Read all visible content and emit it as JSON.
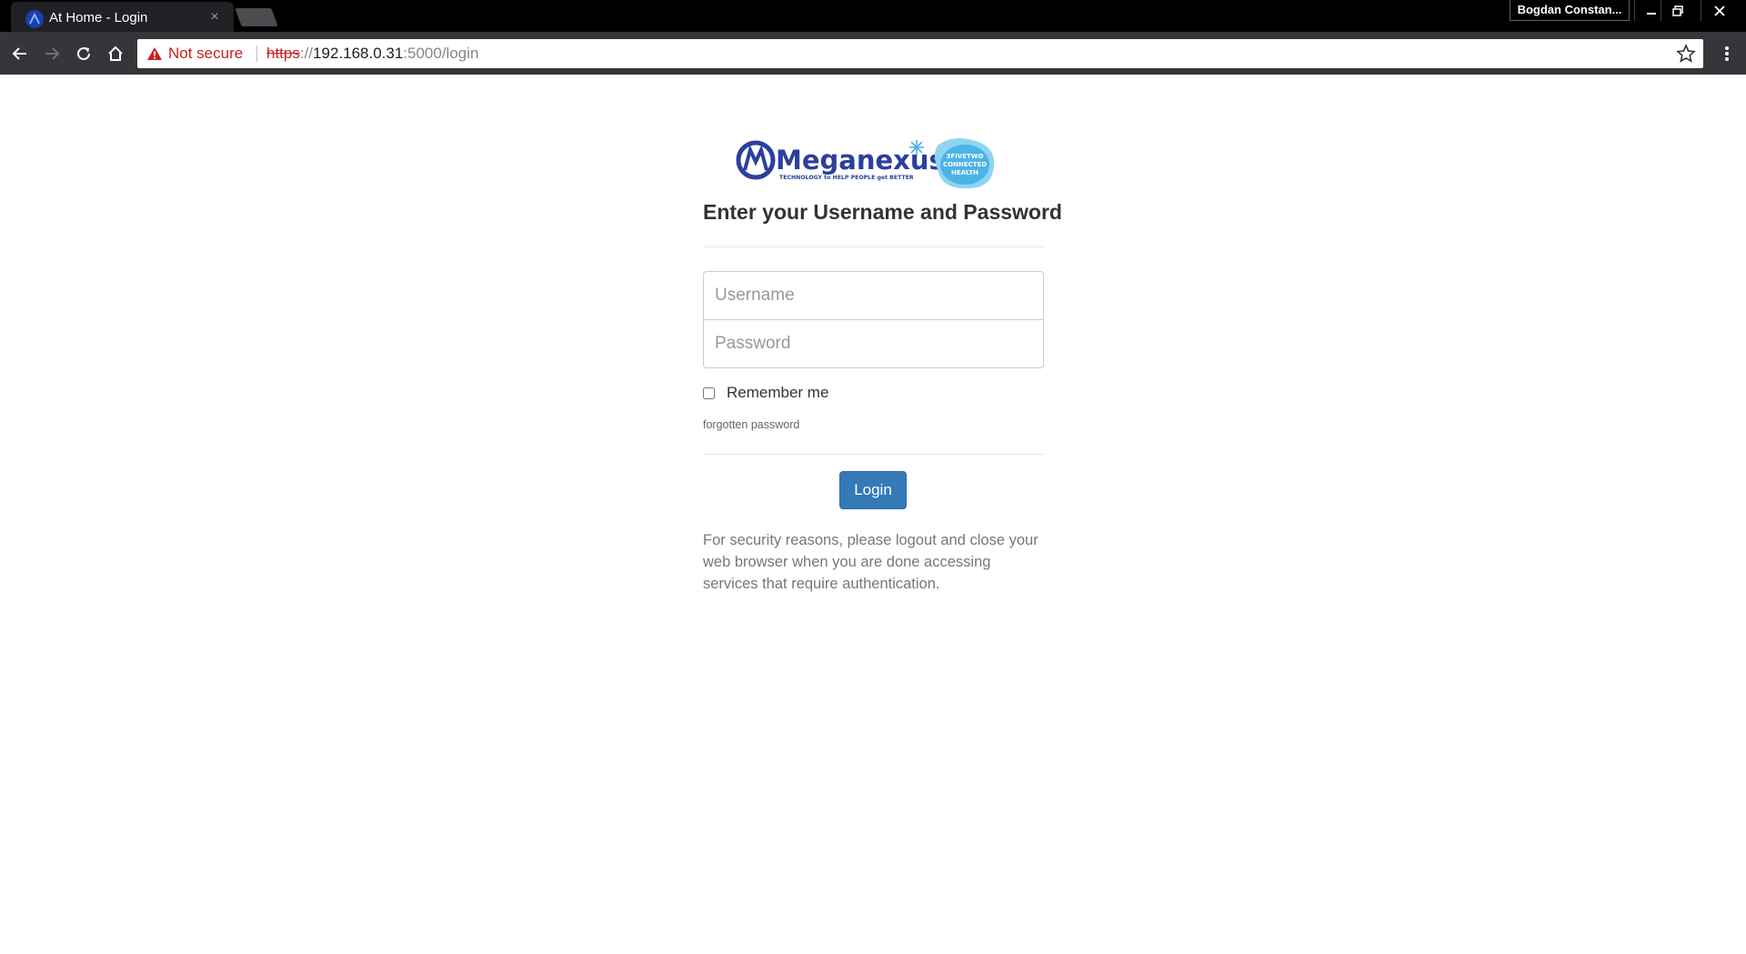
{
  "browser": {
    "tab_title": "At Home - Login",
    "tab_close": "×",
    "profile_name": "Bogdan Constan...",
    "security_label": "Not secure",
    "url_scheme": "https",
    "url_sep": "://",
    "url_host": "192.168.0.31",
    "url_rest": ":5000/login"
  },
  "login": {
    "heading": "Enter your Username and Password",
    "username_placeholder": "Username",
    "password_placeholder": "Password",
    "remember_label": "Remember me",
    "forgot_link": "forgotten password",
    "login_button": "Login",
    "security_notice": "For security reasons, please logout and close your web browser when you are done accessing services that require authentication."
  },
  "logos": {
    "brand_name": "Meganexus",
    "brand_tagline": "TECHNOLOGY to HELP PEOPLE get BETTER",
    "partner_line1": "3FIVETWO",
    "partner_line2": "CONNECTED",
    "partner_line3": "HEALTH"
  },
  "colors": {
    "primary_button": "#337ab7",
    "warning": "#c5221f",
    "brand_blue": "#2b3f9e",
    "partner_blue": "#4bb4e6"
  }
}
